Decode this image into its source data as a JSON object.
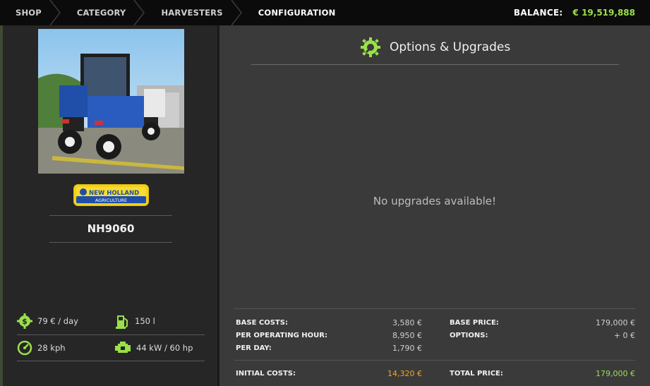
{
  "breadcrumb": {
    "items": [
      "SHOP",
      "CATEGORY",
      "HARVESTERS",
      "CONFIGURATION"
    ]
  },
  "balance": {
    "label": "BALANCE:",
    "value": "€ 19,519,888"
  },
  "vehicle": {
    "brand": "NEW HOLLAND",
    "brand_sub": "AGRICULTURE",
    "name": "NH9060",
    "stats": {
      "cost_per_day": "79 € / day",
      "tank": "150 l",
      "speed": "28 kph",
      "power": "44 kW / 60 hp"
    }
  },
  "options": {
    "title": "Options & Upgrades",
    "empty_message": "No upgrades available!"
  },
  "costs": {
    "base_costs_label": "BASE COSTS:",
    "base_costs_value": "3,580 €",
    "per_hour_label": "PER OPERATING HOUR:",
    "per_hour_value": "8,950 €",
    "per_day_label": "PER DAY:",
    "per_day_value": "1,790 €",
    "initial_label": "INITIAL COSTS:",
    "initial_value": "14,320 €",
    "base_price_label": "BASE PRICE:",
    "base_price_value": "179,000 €",
    "options_label": "OPTIONS:",
    "options_value": "+ 0 €",
    "total_label": "TOTAL PRICE:",
    "total_value": "179,000 €"
  },
  "colors": {
    "accent_green": "#9be04b",
    "accent_orange": "#f5a623",
    "brand_blue": "#1f4fa8",
    "brand_yellow": "#f3d019"
  }
}
